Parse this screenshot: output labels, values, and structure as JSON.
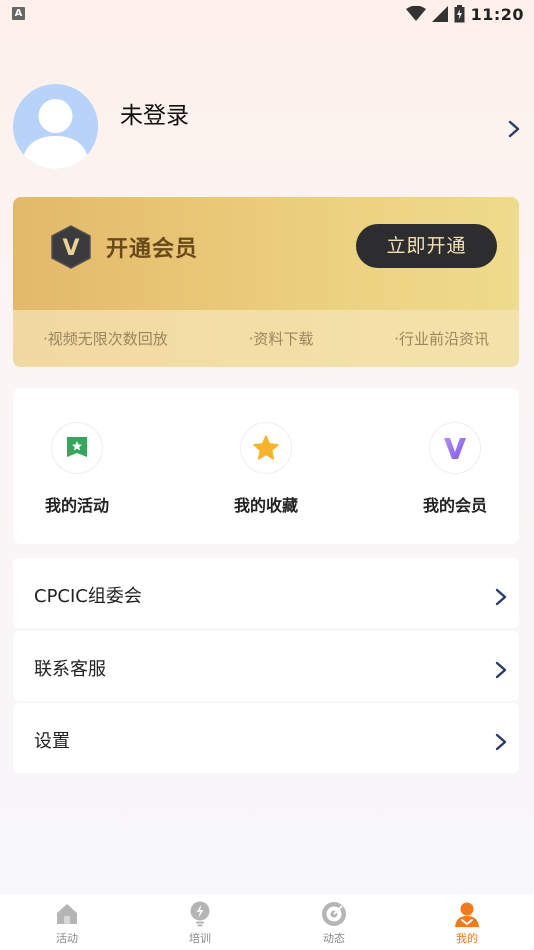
{
  "status_bar": {
    "indicator": "A",
    "time": "11:20"
  },
  "profile": {
    "name": "未登录"
  },
  "vip": {
    "badge": "V",
    "title": "开通会员",
    "button_label": "立即开通",
    "perks": [
      "·视频无限次数回放",
      "·资料下载",
      "·行业前沿资讯"
    ]
  },
  "quick_actions": [
    {
      "label": "我的活动",
      "icon": "activity-icon"
    },
    {
      "label": "我的收藏",
      "icon": "star-icon"
    },
    {
      "label": "我的会员",
      "icon": "vip-v-icon"
    }
  ],
  "menu": [
    {
      "label": "CPCIC组委会"
    },
    {
      "label": "联系客服"
    },
    {
      "label": "设置"
    }
  ],
  "tabs": [
    {
      "label": "活动",
      "icon": "home-icon",
      "active": false
    },
    {
      "label": "培训",
      "icon": "lightbulb-icon",
      "active": false
    },
    {
      "label": "动态",
      "icon": "target-icon",
      "active": false
    },
    {
      "label": "我的",
      "icon": "user-icon",
      "active": true
    }
  ],
  "colors": {
    "accent": "#f07a1d",
    "vip_gold": "#e3b86a",
    "vip_button": "#2d2c2f",
    "chevron": "#2b3a67"
  }
}
